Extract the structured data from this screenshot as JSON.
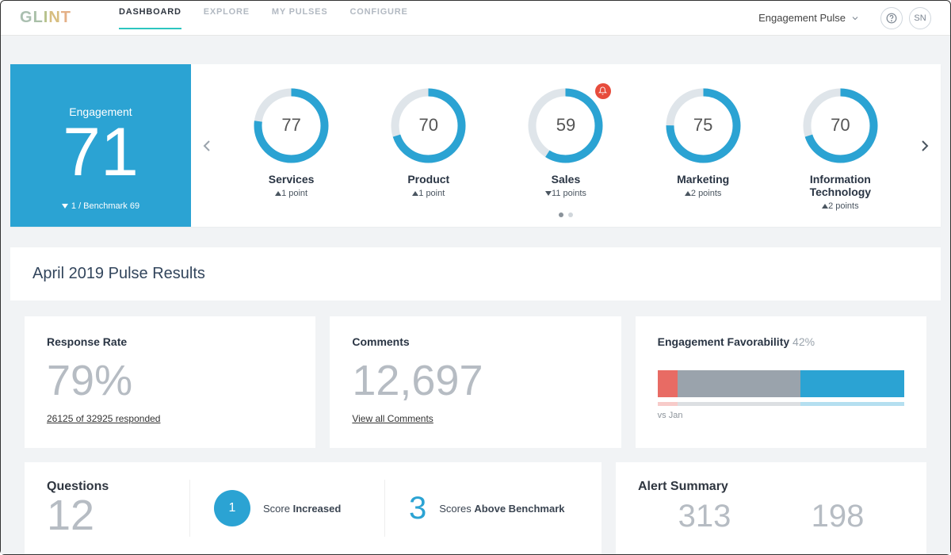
{
  "brand": {
    "letters": [
      "G",
      "L",
      "I",
      "N",
      "T"
    ]
  },
  "nav": {
    "items": [
      "DASHBOARD",
      "EXPLORE",
      "MY PULSES",
      "CONFIGURE"
    ],
    "active": 0
  },
  "header": {
    "pulse_name": "Engagement Pulse",
    "avatar": "SN"
  },
  "hero": {
    "label": "Engagement",
    "score": "71",
    "delta_dir": "down",
    "delta_text": "1 / Benchmark 69",
    "departments": [
      {
        "name": "Services",
        "score": 77,
        "delta_dir": "up",
        "delta_text": "1 point",
        "alert": false
      },
      {
        "name": "Product",
        "score": 70,
        "delta_dir": "up",
        "delta_text": "1 point",
        "alert": false
      },
      {
        "name": "Sales",
        "score": 59,
        "delta_dir": "down",
        "delta_text": "11 points",
        "alert": true
      },
      {
        "name": "Marketing",
        "score": 75,
        "delta_dir": "up",
        "delta_text": "2 points",
        "alert": false
      },
      {
        "name": "Information Technology",
        "score": 70,
        "delta_dir": "up",
        "delta_text": "2 points",
        "alert": false
      }
    ]
  },
  "results_title": "April 2019 Pulse Results",
  "response": {
    "title": "Response Rate",
    "value": "79%",
    "sub": "26125 of 32925 responded"
  },
  "comments": {
    "title": "Comments",
    "value": "12,697",
    "link": "View all Comments"
  },
  "favorability": {
    "title": "Engagement Favorability",
    "pct": "42%",
    "segments": [
      {
        "color": "#e86b64",
        "w": 8
      },
      {
        "color": "#9aa3ac",
        "w": 50
      },
      {
        "color": "#2ba3d3",
        "w": 42
      }
    ],
    "vs_label": "vs Jan"
  },
  "questions": {
    "title": "Questions",
    "count": "12",
    "increased_n": "1",
    "increased_label_a": "Score",
    "increased_label_b": "Increased",
    "bench_n": "3",
    "bench_label_a": "Scores",
    "bench_label_b": "Above Benchmark"
  },
  "alerts": {
    "title": "Alert Summary",
    "a": "313",
    "b": "198"
  },
  "colors": {
    "accent": "#2ba3d3",
    "ring_bg": "#dfe5ea"
  }
}
